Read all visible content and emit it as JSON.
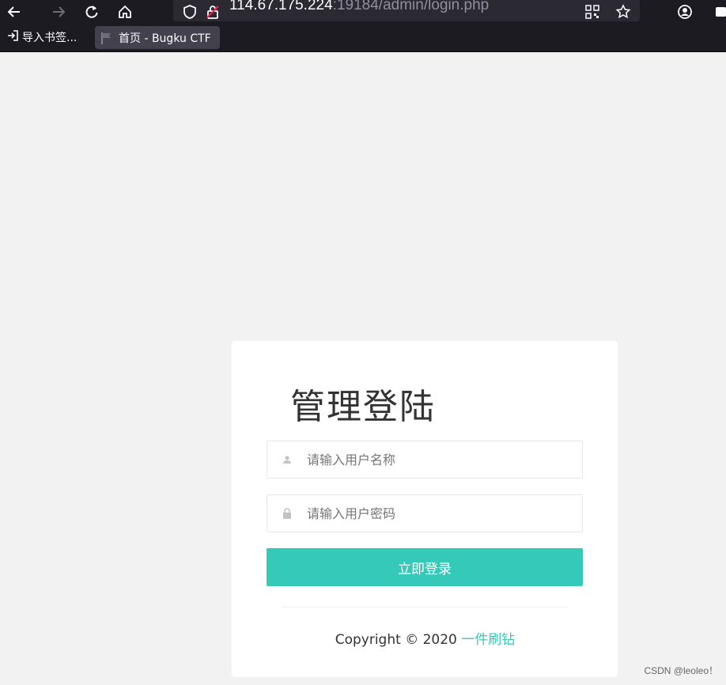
{
  "browser": {
    "url_host": "114.67.175.224",
    "url_path": ":19184/admin/login.php",
    "back_icon": "back-arrow-icon",
    "forward_icon": "forward-arrow-icon",
    "reload_icon": "reload-icon",
    "home_icon": "home-icon",
    "shield_icon": "shield-icon",
    "insecure_icon": "insecure-lock-icon",
    "qr_icon": "qr-code-icon",
    "bookmark_star_icon": "star-icon",
    "account_icon": "account-icon"
  },
  "bookmarks": {
    "import_label": "导入书签...",
    "tab_label": "首页 - Bugku CTF"
  },
  "login": {
    "title": "管理登陆",
    "username_placeholder": "请输入用户名称",
    "password_placeholder": "请输入用户密码",
    "submit_label": "立即登录",
    "copyright_prefix": "Copyright © 2020 ",
    "copyright_brand": "一件刷钻"
  },
  "watermark": "CSDN @leoleo！",
  "colors": {
    "accent": "#35c9b9",
    "page_bg": "#f2f2f2",
    "toolbar_bg": "#1c1b22"
  }
}
